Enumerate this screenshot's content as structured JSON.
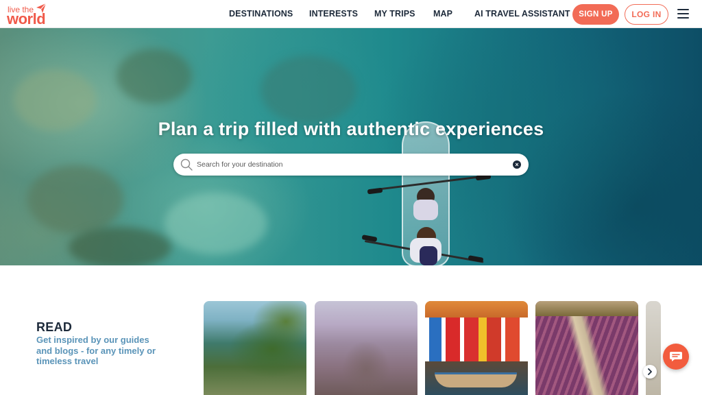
{
  "brand": {
    "logo_line1": "live the",
    "logo_line2": "world",
    "accent_color": "#f26b56"
  },
  "nav": {
    "items": [
      {
        "label": "DESTINATIONS"
      },
      {
        "label": "INTERESTS"
      },
      {
        "label": "MY TRIPS"
      },
      {
        "label": "MAP"
      },
      {
        "label": "AI TRAVEL ASSISTANT"
      }
    ],
    "signup_label": "SIGN UP",
    "login_label": "LOG IN",
    "menu_icon": "hamburger-menu-icon"
  },
  "hero": {
    "title": "Plan a trip filled with authentic experiences",
    "search_placeholder": "Search for your destination",
    "search_icon": "search-icon",
    "clear_icon": "clear-icon"
  },
  "read": {
    "title": "READ",
    "subtitle": "Get inspired by our guides and blogs - for any timely or timeless travel"
  },
  "cards": [
    {
      "image": "coastal-island-village"
    },
    {
      "image": "city-cathedral-at-dusk"
    },
    {
      "image": "colorful-boathouses"
    },
    {
      "image": "lavender-field-path"
    },
    {
      "image": "partial-card"
    }
  ],
  "carousel": {
    "next_icon": "chevron-right-icon"
  },
  "chat": {
    "icon": "chat-bubble-icon"
  }
}
